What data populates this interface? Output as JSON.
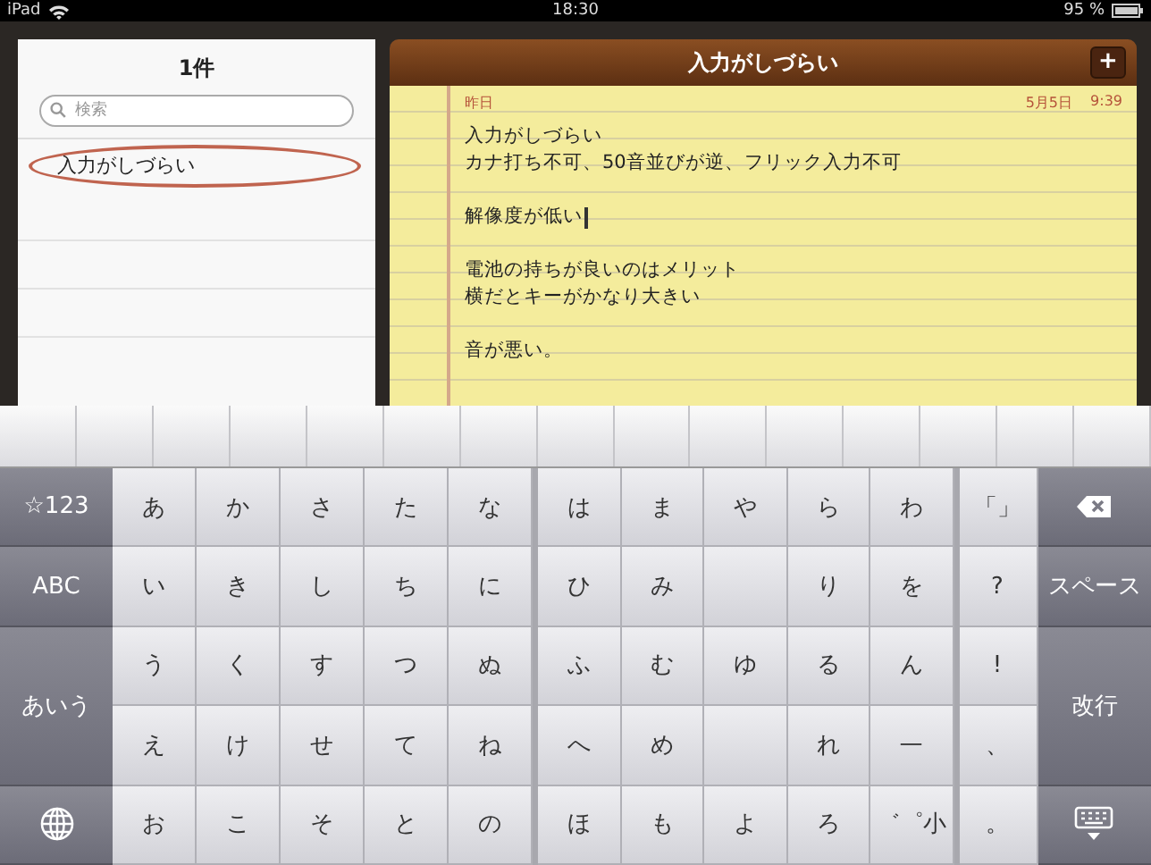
{
  "status_bar": {
    "device": "iPad",
    "time": "18:30",
    "battery": "95 %"
  },
  "sidebar": {
    "title": "1件",
    "search": {
      "placeholder": "検索"
    },
    "items": [
      {
        "title": "入力がしづらい",
        "selected": true
      }
    ]
  },
  "note": {
    "title": "入力がしづらい",
    "add_button": "+",
    "day": "昨日",
    "date": "5月5日",
    "time": "9:39",
    "paragraphs": [
      {
        "lines": [
          "入力がしづらい",
          "カナ打ち不可、50音並びが逆、フリック入力不可"
        ],
        "cursor": false
      },
      {
        "lines": [
          "解像度が低い"
        ],
        "cursor": true
      },
      {
        "lines": [
          "電池の持ちが良いのはメリット",
          "横だとキーがかなり大きい"
        ],
        "cursor": false
      },
      {
        "lines": [
          "音が悪い。"
        ],
        "cursor": false
      }
    ]
  },
  "keyboard": {
    "left_keys": [
      {
        "kind": "text",
        "label": "☆123"
      },
      {
        "kind": "text",
        "label": "ABC"
      },
      {
        "kind": "tall",
        "label": "あいう"
      },
      {
        "kind": "globe"
      }
    ],
    "right_keys": [
      {
        "kind": "backspace"
      },
      {
        "kind": "text",
        "label": "スペース"
      },
      {
        "kind": "tall",
        "label": "改行"
      },
      {
        "kind": "hide"
      }
    ],
    "rows": [
      [
        "あ",
        "か",
        "さ",
        "た",
        "な",
        "は",
        "ま",
        "や",
        "ら",
        "わ",
        "「」"
      ],
      [
        "い",
        "き",
        "し",
        "ち",
        "に",
        "ひ",
        "み",
        null,
        "り",
        "を",
        "?"
      ],
      [
        "う",
        "く",
        "す",
        "つ",
        "ぬ",
        "ふ",
        "む",
        "ゆ",
        "る",
        "ん",
        "!"
      ],
      [
        "え",
        "け",
        "せ",
        "て",
        "ね",
        "へ",
        "め",
        null,
        "れ",
        "—",
        "、"
      ],
      [
        "お",
        "こ",
        "そ",
        "と",
        "の",
        "ほ",
        "も",
        "よ",
        "ろ",
        "゛゜小",
        "。"
      ]
    ]
  }
}
